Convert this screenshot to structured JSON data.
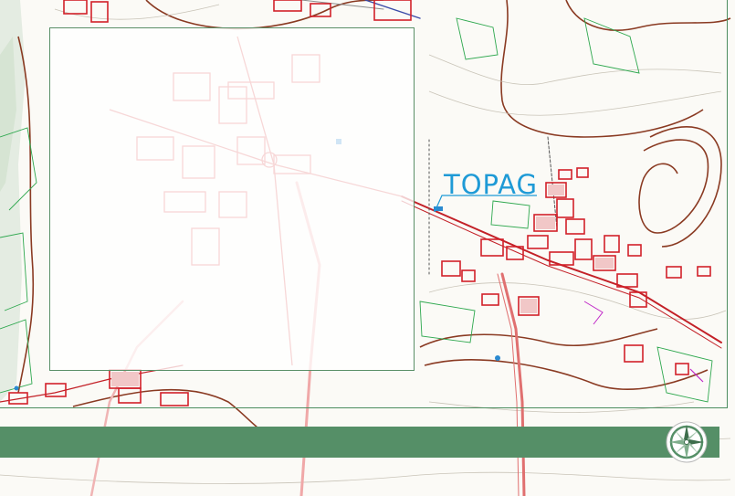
{
  "brand": {
    "name": "TOPAG",
    "color": "#1e9ad6"
  },
  "colors": {
    "band": "#558f67",
    "frame": "#4c8d5f",
    "buildings": "#d2202a",
    "contours": "#8a3a22",
    "vegetation": "#2fa84f"
  },
  "icons": {
    "compass": "compass-rose-icon"
  }
}
